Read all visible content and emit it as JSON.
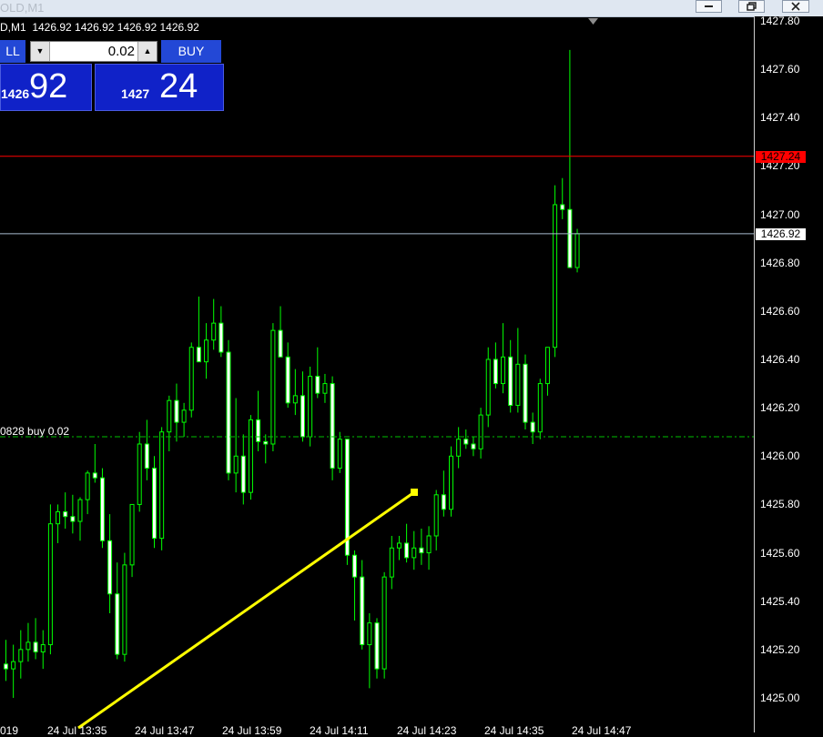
{
  "window": {
    "title": "OLD,M1",
    "buttons": [
      "minimize",
      "restore",
      "close"
    ]
  },
  "chart": {
    "header_label": "D,M1  1426.92 1426.92 1426.92 1426.92",
    "background": "#000000",
    "candle_color": "#00ff00",
    "bull_fill": "#000000",
    "bear_fill": "#ffffff",
    "trendline_color": "#ffff00",
    "ask_line_color": "#ff0000",
    "bid_line_color": "#a8bdd0",
    "order_line_color": "#00c000"
  },
  "trade_panel": {
    "sell_label": "LL",
    "buy_label": "BUY",
    "lot_value": "0.02",
    "sell_small": "1426",
    "sell_big": "92",
    "buy_small": "1427",
    "buy_big": "24"
  },
  "price_axis": {
    "labels": [
      "1427.80",
      "1427.60",
      "1427.40",
      "1427.20",
      "1427.00",
      "1426.80",
      "1426.60",
      "1426.40",
      "1426.20",
      "1426.00",
      "1425.80",
      "1425.60",
      "1425.40",
      "1425.20",
      "1425.00"
    ],
    "ask_tag": "1427.24",
    "bid_tag": "1426.92"
  },
  "time_axis": {
    "labels": [
      "019",
      "24 Jul 13:35",
      "24 Jul 13:47",
      "24 Jul 13:59",
      "24 Jul 14:11",
      "24 Jul 14:23",
      "24 Jul 14:35",
      "24 Jul 14:47"
    ]
  },
  "order_line": {
    "label": "0828 buy 0.02",
    "price": 1426.08
  },
  "prices": {
    "ask": 1427.24,
    "bid": 1426.92
  },
  "candles": [
    [
      1425.14,
      1425.24,
      1425.07,
      1425.12
    ],
    [
      1425.12,
      1425.22,
      1425.0,
      1425.15
    ],
    [
      1425.15,
      1425.28,
      1425.08,
      1425.2
    ],
    [
      1425.2,
      1425.31,
      1425.15,
      1425.23
    ],
    [
      1425.23,
      1425.33,
      1425.16,
      1425.19
    ],
    [
      1425.19,
      1425.28,
      1425.12,
      1425.22
    ],
    [
      1425.22,
      1425.8,
      1425.18,
      1425.72
    ],
    [
      1425.72,
      1425.8,
      1425.64,
      1425.77
    ],
    [
      1425.77,
      1425.85,
      1425.7,
      1425.75
    ],
    [
      1425.75,
      1425.84,
      1425.68,
      1425.73
    ],
    [
      1425.73,
      1425.83,
      1425.65,
      1425.82
    ],
    [
      1425.82,
      1425.94,
      1425.76,
      1425.93
    ],
    [
      1425.93,
      1426.05,
      1425.89,
      1425.91
    ],
    [
      1425.91,
      1425.95,
      1425.62,
      1425.65
    ],
    [
      1425.65,
      1425.76,
      1425.35,
      1425.43
    ],
    [
      1425.43,
      1425.56,
      1425.16,
      1425.18
    ],
    [
      1425.18,
      1425.6,
      1425.15,
      1425.55
    ],
    [
      1425.55,
      1425.67,
      1425.5,
      1425.8
    ],
    [
      1425.8,
      1426.1,
      1425.77,
      1426.05
    ],
    [
      1426.05,
      1426.15,
      1425.9,
      1425.95
    ],
    [
      1425.95,
      1426.0,
      1425.62,
      1425.66
    ],
    [
      1425.66,
      1426.12,
      1425.61,
      1426.1
    ],
    [
      1426.1,
      1426.25,
      1426.02,
      1426.23
    ],
    [
      1426.23,
      1426.3,
      1426.06,
      1426.14
    ],
    [
      1426.14,
      1426.22,
      1426.08,
      1426.19
    ],
    [
      1426.19,
      1426.47,
      1426.16,
      1426.45
    ],
    [
      1426.45,
      1426.66,
      1426.4,
      1426.39
    ],
    [
      1426.39,
      1426.55,
      1426.32,
      1426.48
    ],
    [
      1426.48,
      1426.65,
      1426.44,
      1426.55
    ],
    [
      1426.55,
      1426.62,
      1426.41,
      1426.43
    ],
    [
      1426.43,
      1426.48,
      1425.9,
      1425.93
    ],
    [
      1425.93,
      1426.24,
      1425.85,
      1426.0
    ],
    [
      1426.0,
      1426.09,
      1425.8,
      1425.85
    ],
    [
      1425.85,
      1426.17,
      1425.82,
      1426.15
    ],
    [
      1426.15,
      1426.27,
      1426.02,
      1426.06
    ],
    [
      1426.06,
      1426.09,
      1425.97,
      1426.05
    ],
    [
      1426.05,
      1426.55,
      1426.02,
      1426.52
    ],
    [
      1426.52,
      1426.62,
      1426.41,
      1426.41
    ],
    [
      1426.41,
      1426.47,
      1426.2,
      1426.22
    ],
    [
      1426.22,
      1426.36,
      1426.17,
      1426.25
    ],
    [
      1426.25,
      1426.35,
      1426.06,
      1426.08
    ],
    [
      1426.08,
      1426.37,
      1426.04,
      1426.33
    ],
    [
      1426.33,
      1426.45,
      1426.24,
      1426.26
    ],
    [
      1426.26,
      1426.34,
      1426.22,
      1426.3
    ],
    [
      1426.3,
      1426.33,
      1425.9,
      1425.95
    ],
    [
      1425.95,
      1426.1,
      1425.93,
      1426.07
    ],
    [
      1426.07,
      1426.07,
      1425.55,
      1425.59
    ],
    [
      1425.59,
      1425.61,
      1425.32,
      1425.5
    ],
    [
      1425.5,
      1425.57,
      1425.2,
      1425.22
    ],
    [
      1425.22,
      1425.35,
      1425.04,
      1425.31
    ],
    [
      1425.31,
      1425.33,
      1425.08,
      1425.12
    ],
    [
      1425.12,
      1425.52,
      1425.08,
      1425.5
    ],
    [
      1425.5,
      1425.67,
      1425.45,
      1425.62
    ],
    [
      1425.62,
      1425.67,
      1425.57,
      1425.64
    ],
    [
      1425.64,
      1425.72,
      1425.56,
      1425.58
    ],
    [
      1425.58,
      1425.69,
      1425.53,
      1425.62
    ],
    [
      1425.62,
      1425.7,
      1425.55,
      1425.6
    ],
    [
      1425.6,
      1425.71,
      1425.53,
      1425.67
    ],
    [
      1425.67,
      1425.86,
      1425.61,
      1425.84
    ],
    [
      1425.84,
      1425.94,
      1425.75,
      1425.78
    ],
    [
      1425.78,
      1426.04,
      1425.75,
      1426.0
    ],
    [
      1426.0,
      1426.12,
      1425.95,
      1426.07
    ],
    [
      1426.07,
      1426.11,
      1426.03,
      1426.05
    ],
    [
      1426.05,
      1426.08,
      1426.0,
      1426.03
    ],
    [
      1426.03,
      1426.2,
      1425.99,
      1426.17
    ],
    [
      1426.17,
      1426.45,
      1426.12,
      1426.4
    ],
    [
      1426.4,
      1426.47,
      1426.28,
      1426.3
    ],
    [
      1426.3,
      1426.55,
      1426.26,
      1426.41
    ],
    [
      1426.41,
      1426.48,
      1426.18,
      1426.21
    ],
    [
      1426.21,
      1426.53,
      1426.18,
      1426.38
    ],
    [
      1426.38,
      1426.42,
      1426.11,
      1426.14
    ],
    [
      1426.14,
      1426.18,
      1426.05,
      1426.1
    ],
    [
      1426.1,
      1426.32,
      1426.07,
      1426.3
    ],
    [
      1426.3,
      1426.42,
      1426.25,
      1426.45
    ],
    [
      1426.45,
      1427.12,
      1426.41,
      1427.04
    ],
    [
      1427.04,
      1427.15,
      1426.98,
      1427.02
    ],
    [
      1427.02,
      1427.68,
      1426.91,
      1426.78
    ],
    [
      1426.78,
      1426.94,
      1426.76,
      1426.92
    ]
  ]
}
